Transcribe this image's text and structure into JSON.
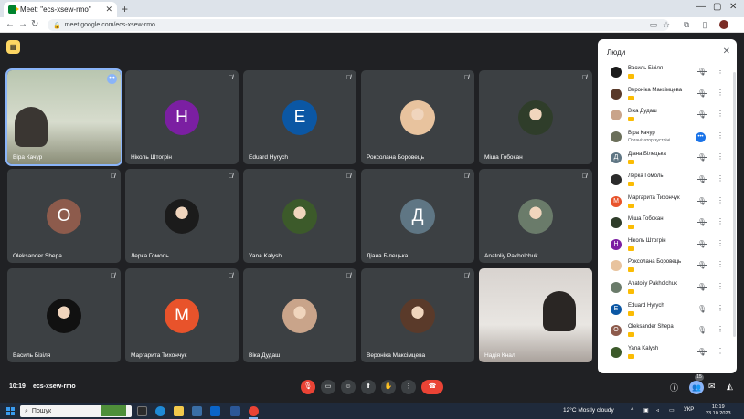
{
  "browser": {
    "tab_title": "Meet: \"ecs-xsew-rmo\"",
    "url": "meet.google.com/ecs-xsew-rmo"
  },
  "meet": {
    "tiles": [
      {
        "name": "Віра Качур",
        "type": "video",
        "selected": true
      },
      {
        "name": "Ніколь Штогрін",
        "type": "letter",
        "letter": "Н",
        "color": "#7b1fa2"
      },
      {
        "name": "Eduard Hyrych",
        "type": "letter",
        "letter": "E",
        "color": "#0b57a4"
      },
      {
        "name": "Роксолана Боровець",
        "type": "photo",
        "color": "#e8c39e"
      },
      {
        "name": "Міша Гобокан",
        "type": "photo",
        "color": "#2f3d2a"
      },
      {
        "name": "Oleksander Shepa",
        "type": "letter",
        "letter": "O",
        "color": "#8d5b4c"
      },
      {
        "name": "Лерка Гомоль",
        "type": "photo",
        "color": "#1b1b1b"
      },
      {
        "name": "Yana Kalysh",
        "type": "photo",
        "color": "#3c5a2a"
      },
      {
        "name": "Діана Білецька",
        "type": "letter",
        "letter": "Д",
        "color": "#5f7684"
      },
      {
        "name": "Anatoliy Pakholchuk",
        "type": "photo",
        "color": "#6a7b6a"
      },
      {
        "name": "Василь Бізіля",
        "type": "photo",
        "color": "#111111"
      },
      {
        "name": "Маргарита Тихончук",
        "type": "letter",
        "letter": "М",
        "color": "#e8532b"
      },
      {
        "name": "Віка Дудаш",
        "type": "photo",
        "color": "#c9a48a"
      },
      {
        "name": "Вероніка Максімцева",
        "type": "photo",
        "color": "#5a3a2a"
      },
      {
        "name": "Надія Кнал",
        "type": "video"
      }
    ],
    "clock": "10:19",
    "meeting_code": "ecs-xsew-rmo",
    "participant_count": "15"
  },
  "people_panel": {
    "title": "Люди",
    "people": [
      {
        "name": "Василь Бізіля",
        "avatar_color": "#1b1b1b"
      },
      {
        "name": "Вероніка Максімцева",
        "avatar_color": "#5a3a2a"
      },
      {
        "name": "Віка Дудаш",
        "avatar_color": "#c9a48a"
      },
      {
        "name": "Віра Качур",
        "subtitle": "Організатор зустрічі",
        "avatar_color": "#6b6f5a",
        "host": true
      },
      {
        "name": "Діана Білецька",
        "avatar_color": "#5f7684",
        "letter": "Д"
      },
      {
        "name": "Лерка Гомоль",
        "avatar_color": "#2b2b2b"
      },
      {
        "name": "Маргарита Тихончук",
        "avatar_color": "#e8532b",
        "letter": "М"
      },
      {
        "name": "Міша Гобокан",
        "avatar_color": "#2f3d2a"
      },
      {
        "name": "Ніколь Штогрін",
        "avatar_color": "#7b1fa2",
        "letter": "Н"
      },
      {
        "name": "Роксолана Боровець",
        "avatar_color": "#e8c39e"
      },
      {
        "name": "Anatoliy Pakholchuk",
        "avatar_color": "#6a7b6a"
      },
      {
        "name": "Eduard Hyrych",
        "avatar_color": "#0b57a4",
        "letter": "E"
      },
      {
        "name": "Oleksander Shepa",
        "avatar_color": "#8d5b4c",
        "letter": "O"
      },
      {
        "name": "Yana Kalysh",
        "avatar_color": "#3c5a2a"
      }
    ]
  },
  "taskbar": {
    "search_placeholder": "Пошук",
    "weather": "12°C  Mostly cloudy",
    "language": "УКР",
    "time": "10:19",
    "date": "23.10.2023"
  }
}
